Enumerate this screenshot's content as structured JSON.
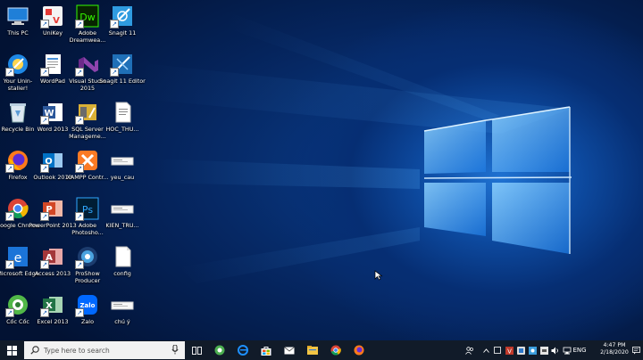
{
  "desktop": {
    "icons": [
      {
        "label": "This PC",
        "icon": "this-pc-icon"
      },
      {
        "label": "UniKey",
        "icon": "unikey-icon"
      },
      {
        "label": "Adobe Dreamwea...",
        "icon": "dreamweaver-icon",
        "abbr": "Dw"
      },
      {
        "label": "Snagit 11",
        "icon": "snagit-icon"
      },
      {
        "label": "Your Unin-staller!",
        "icon": "uninstaller-icon"
      },
      {
        "label": "WordPad",
        "icon": "wordpad-icon"
      },
      {
        "label": "Visual Studio 2015",
        "icon": "visual-studio-icon"
      },
      {
        "label": "Snagit 11 Editor",
        "icon": "snagit-editor-icon"
      },
      {
        "label": "Recycle Bin",
        "icon": "recycle-bin-icon"
      },
      {
        "label": "Word 2013",
        "icon": "word-icon",
        "abbr": "W"
      },
      {
        "label": "SQL Server Manageme...",
        "icon": "sql-server-icon"
      },
      {
        "label": "HOC_THU...",
        "icon": "document-icon"
      },
      {
        "label": "Firefox",
        "icon": "firefox-icon"
      },
      {
        "label": "Outlook 2013",
        "icon": "outlook-icon",
        "abbr": "O"
      },
      {
        "label": "XAMPP Contr...",
        "icon": "xampp-icon"
      },
      {
        "label": "yeu_cau",
        "icon": "image-file-icon"
      },
      {
        "label": "Google Chrome",
        "icon": "chrome-icon"
      },
      {
        "label": "PowerPoint 2013",
        "icon": "powerpoint-icon",
        "abbr": "P"
      },
      {
        "label": "Adobe Photosho...",
        "icon": "photoshop-icon",
        "abbr": "Ps"
      },
      {
        "label": "KIEN_TRU...",
        "icon": "image-file-icon"
      },
      {
        "label": "Microsoft Edge",
        "icon": "edge-icon",
        "abbr": "e"
      },
      {
        "label": "Access 2013",
        "icon": "access-icon",
        "abbr": "A"
      },
      {
        "label": "ProShow Producer",
        "icon": "proshow-icon"
      },
      {
        "label": "config",
        "icon": "blank-file-icon"
      },
      {
        "label": "Cốc Cốc",
        "icon": "coccoc-icon"
      },
      {
        "label": "Excel 2013",
        "icon": "excel-icon",
        "abbr": "X"
      },
      {
        "label": "Zalo",
        "icon": "zalo-icon",
        "abbr": "Zalo"
      },
      {
        "label": "chú ý",
        "icon": "image-file-icon"
      }
    ]
  },
  "taskbar": {
    "search_placeholder": "Type here to search",
    "pinned": [
      "task-view-icon",
      "coccoc-icon",
      "edge-icon",
      "store-icon",
      "mail-icon",
      "file-explorer-icon",
      "chrome-icon",
      "firefox-icon"
    ],
    "tray_language": "ENG",
    "time": "4:47 PM",
    "date": "2/18/2020"
  },
  "colors": {
    "taskbar": "#111b29",
    "accent": "#1b74d8",
    "search_bg": "#f2f2f2"
  }
}
